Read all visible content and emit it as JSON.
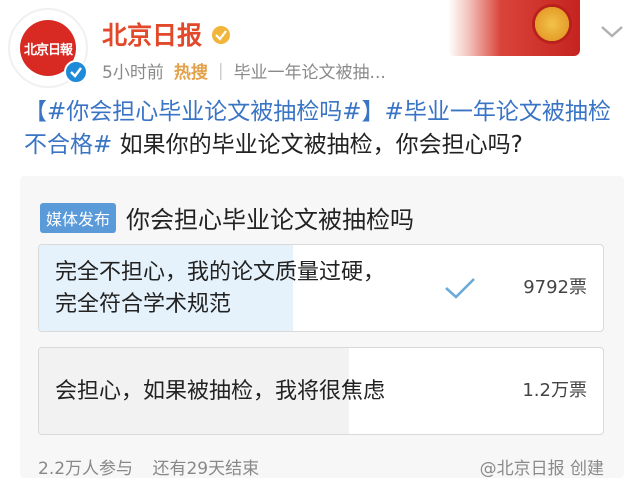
{
  "header": {
    "avatar_text": "北京日報",
    "account_name": "北京日报",
    "time": "5小时前",
    "hot_label": "热搜",
    "topic": "毕业一年论文被抽..."
  },
  "post": {
    "tag1": "【#你会担心毕业论文被抽检吗#】",
    "tag2": "#毕业一年论文被抽检不合格#",
    "body": " 如果你的毕业论文被抽检，你会担心吗?"
  },
  "poll": {
    "badge": "媒体发布",
    "title": "你会担心毕业论文被抽检吗",
    "options": [
      {
        "label_line1": "完全不担心，我的论文质量过硬，",
        "label_line2": "完全符合学术规范",
        "votes": "9792票",
        "selected": true,
        "share": 0.45
      },
      {
        "label_line1": "会担心，如果被抽检，我将很焦虑",
        "label_line2": "",
        "votes": "1.2万票",
        "selected": false,
        "share": 0.55
      }
    ],
    "participants": "2.2万人参与",
    "remaining": "还有29天结束",
    "creator": "@北京日报 创建"
  },
  "icons": {
    "verified": "verified-icon",
    "badge": "gold-badge-icon",
    "chevron": "chevron-down-icon",
    "check": "check-icon"
  },
  "colors": {
    "brand_red": "#e2482a",
    "link_blue": "#3a74c4",
    "verified_blue": "#1f8bd8",
    "hot_orange": "#e3a24a"
  }
}
